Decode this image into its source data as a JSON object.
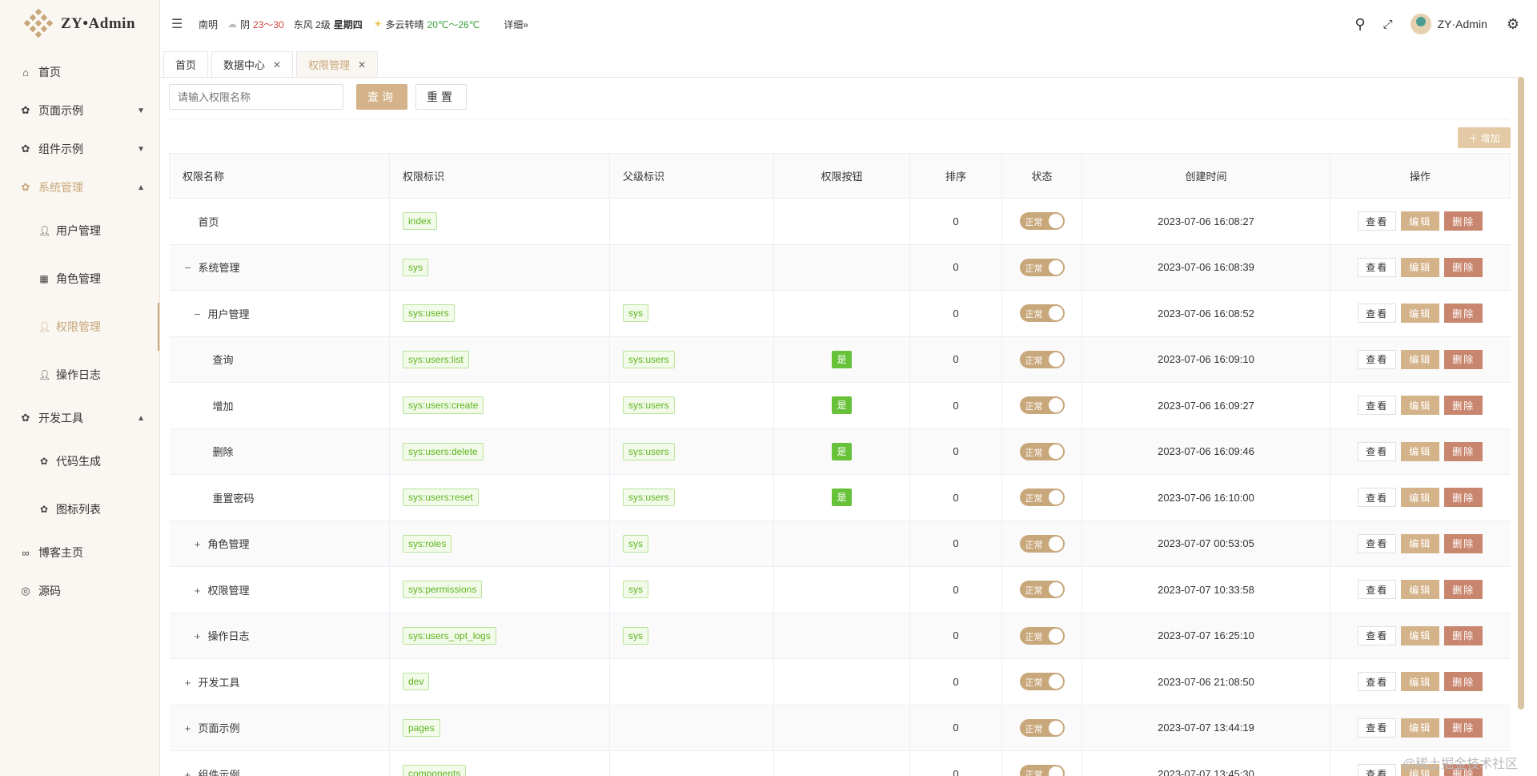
{
  "app": {
    "title": "ZY•Admin"
  },
  "sidebar": {
    "items": [
      {
        "label": "首页",
        "icon": "home-icon"
      },
      {
        "label": "页面示例",
        "icon": "gear-icon"
      },
      {
        "label": "组件示例",
        "icon": "gear-icon"
      },
      {
        "label": "系统管理",
        "icon": "gear-icon"
      },
      {
        "label": "用户管理",
        "icon": "user-icon"
      },
      {
        "label": "角色管理",
        "icon": "grid-icon"
      },
      {
        "label": "权限管理",
        "icon": "user-icon"
      },
      {
        "label": "操作日志",
        "icon": "user-icon"
      },
      {
        "label": "开发工具",
        "icon": "gear-icon"
      },
      {
        "label": "代码生成",
        "icon": "gear-icon"
      },
      {
        "label": "图标列表",
        "icon": "gear-icon"
      },
      {
        "label": "博客主页",
        "icon": "link-icon"
      },
      {
        "label": "源码",
        "icon": "github-icon"
      }
    ]
  },
  "header": {
    "city": "南明",
    "weather1": "阴",
    "temp1": "23～30",
    "wind": "东风 2级",
    "weekday": "星期四",
    "weather2": "多云转晴",
    "temp2": "20℃～26℃",
    "detail": "详细»",
    "username": "ZY·Admin"
  },
  "tabs": [
    {
      "label": "首页"
    },
    {
      "label": "数据中心"
    },
    {
      "label": "权限管理"
    }
  ],
  "search": {
    "placeholder": "请输入权限名称",
    "query_label": "查询",
    "reset_label": "重置",
    "add_label": "增加"
  },
  "table": {
    "headers": [
      "权限名称",
      "权限标识",
      "父级标识",
      "权限按钮",
      "排序",
      "状态",
      "创建时间",
      "操作"
    ],
    "status_label": "正常",
    "yes_label": "是",
    "view_label": "查看",
    "edit_label": "编辑",
    "delete_label": "删除",
    "rows": [
      {
        "name": "首页",
        "toggle": "",
        "indent": 0,
        "code": "index",
        "parent": "",
        "button": "",
        "sort": "0",
        "time": "2023-07-06 16:08:27"
      },
      {
        "name": "系统管理",
        "toggle": "−",
        "indent": 0,
        "code": "sys",
        "parent": "",
        "button": "",
        "sort": "0",
        "time": "2023-07-06 16:08:39"
      },
      {
        "name": "用户管理",
        "toggle": "−",
        "indent": 1,
        "code": "sys:users",
        "parent": "sys",
        "button": "",
        "sort": "0",
        "time": "2023-07-06 16:08:52"
      },
      {
        "name": "查询",
        "toggle": "",
        "indent": 2,
        "code": "sys:users:list",
        "parent": "sys:users",
        "button": "是",
        "sort": "0",
        "time": "2023-07-06 16:09:10"
      },
      {
        "name": "增加",
        "toggle": "",
        "indent": 2,
        "code": "sys:users:create",
        "parent": "sys:users",
        "button": "是",
        "sort": "0",
        "time": "2023-07-06 16:09:27"
      },
      {
        "name": "删除",
        "toggle": "",
        "indent": 2,
        "code": "sys:users:delete",
        "parent": "sys:users",
        "button": "是",
        "sort": "0",
        "time": "2023-07-06 16:09:46"
      },
      {
        "name": "重置密码",
        "toggle": "",
        "indent": 2,
        "code": "sys:users:reset",
        "parent": "sys:users",
        "button": "是",
        "sort": "0",
        "time": "2023-07-06 16:10:00"
      },
      {
        "name": "角色管理",
        "toggle": "+",
        "indent": 1,
        "code": "sys:roles",
        "parent": "sys",
        "button": "",
        "sort": "0",
        "time": "2023-07-07 00:53:05"
      },
      {
        "name": "权限管理",
        "toggle": "+",
        "indent": 1,
        "code": "sys:permissions",
        "parent": "sys",
        "button": "",
        "sort": "0",
        "time": "2023-07-07 10:33:58"
      },
      {
        "name": "操作日志",
        "toggle": "+",
        "indent": 1,
        "code": "sys:users_opt_logs",
        "parent": "sys",
        "button": "",
        "sort": "0",
        "time": "2023-07-07 16:25:10"
      },
      {
        "name": "开发工具",
        "toggle": "+",
        "indent": 0,
        "code": "dev",
        "parent": "",
        "button": "",
        "sort": "0",
        "time": "2023-07-06 21:08:50"
      },
      {
        "name": "页面示例",
        "toggle": "+",
        "indent": 0,
        "code": "pages",
        "parent": "",
        "button": "",
        "sort": "0",
        "time": "2023-07-07 13:44:19"
      },
      {
        "name": "组件示例",
        "toggle": "+",
        "indent": 0,
        "code": "components",
        "parent": "",
        "button": "",
        "sort": "0",
        "time": "2023-07-07 13:45:30"
      }
    ]
  },
  "watermark": "@稀土掘金技术社区",
  "colors": {
    "accent": "#c8a77b",
    "tag_green": "#5fb31f",
    "yes_green": "#67c23a",
    "delete": "#c9866e"
  }
}
